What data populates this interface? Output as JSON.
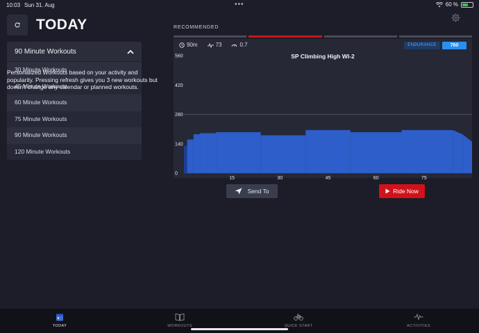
{
  "status_bar": {
    "time": "10:03",
    "date": "Sun 31. Aug",
    "battery_pct": "60 %",
    "battery_level": 0.6
  },
  "header": {
    "title": "TODAY",
    "refresh_icon": "refresh-icon"
  },
  "dropdown": {
    "selected": "90 Minute Workouts",
    "options": [
      "30 Minute Workouts",
      "45 Minute Workouts",
      "60 Minute Workouts",
      "75 Minute Workouts",
      "90 Minute Workouts",
      "120 Minute Workouts"
    ],
    "description": "Personalized Workouts based on your activity and popularity. Pressing refresh gives you 3 new workouts but doesn't change any calendar or planned workouts."
  },
  "recommended": {
    "label": "RECOMMENDED",
    "active_tab": 1,
    "tab_count": 4
  },
  "workout": {
    "duration": "90m",
    "tss": "73",
    "intensity": "0.7",
    "category": "ENDURANCE",
    "score": "760",
    "title": "SP Climbing High WI-2"
  },
  "chart_data": {
    "type": "area",
    "title": "SP Climbing High WI-2",
    "xlabel": "",
    "ylabel": "",
    "x_ticks": [
      15,
      30,
      45,
      60,
      75
    ],
    "y_ticks": [
      0,
      140,
      280,
      420,
      560
    ],
    "xlim": [
      0,
      90
    ],
    "ylim": [
      0,
      560
    ],
    "gridlines_y": [
      280
    ],
    "segments": [
      {
        "x0": 0,
        "x1": 1,
        "y0": 130,
        "y1": 130
      },
      {
        "x0": 1,
        "x1": 3,
        "y0": 160,
        "y1": 160
      },
      {
        "x0": 3,
        "x1": 5,
        "y0": 185,
        "y1": 185
      },
      {
        "x0": 5,
        "x1": 10,
        "y0": 190,
        "y1": 190
      },
      {
        "x0": 10,
        "x1": 24,
        "y0": 195,
        "y1": 195
      },
      {
        "x0": 24,
        "x1": 38,
        "y0": 180,
        "y1": 180
      },
      {
        "x0": 38,
        "x1": 52,
        "y0": 205,
        "y1": 205
      },
      {
        "x0": 52,
        "x1": 68,
        "y0": 195,
        "y1": 195
      },
      {
        "x0": 68,
        "x1": 84,
        "y0": 205,
        "y1": 205
      },
      {
        "x0": 84,
        "x1": 87,
        "y0": 205,
        "y1": 185
      },
      {
        "x0": 87,
        "x1": 90,
        "y0": 185,
        "y1": 150
      }
    ],
    "fill_color": "#2d5ec9",
    "low_segment_color": "#1e3d99"
  },
  "actions": {
    "send_label": "Send To",
    "ride_label": "Ride Now"
  },
  "bottom_nav": {
    "items": [
      {
        "label": "TODAY",
        "icon": "calendar-icon",
        "active": true
      },
      {
        "label": "WORKOUTS",
        "icon": "book-icon",
        "active": false
      },
      {
        "label": "QUICK START",
        "icon": "bicycle-icon",
        "active": false
      },
      {
        "label": "ACTIVITIES",
        "icon": "pulse-icon",
        "active": false
      }
    ]
  }
}
